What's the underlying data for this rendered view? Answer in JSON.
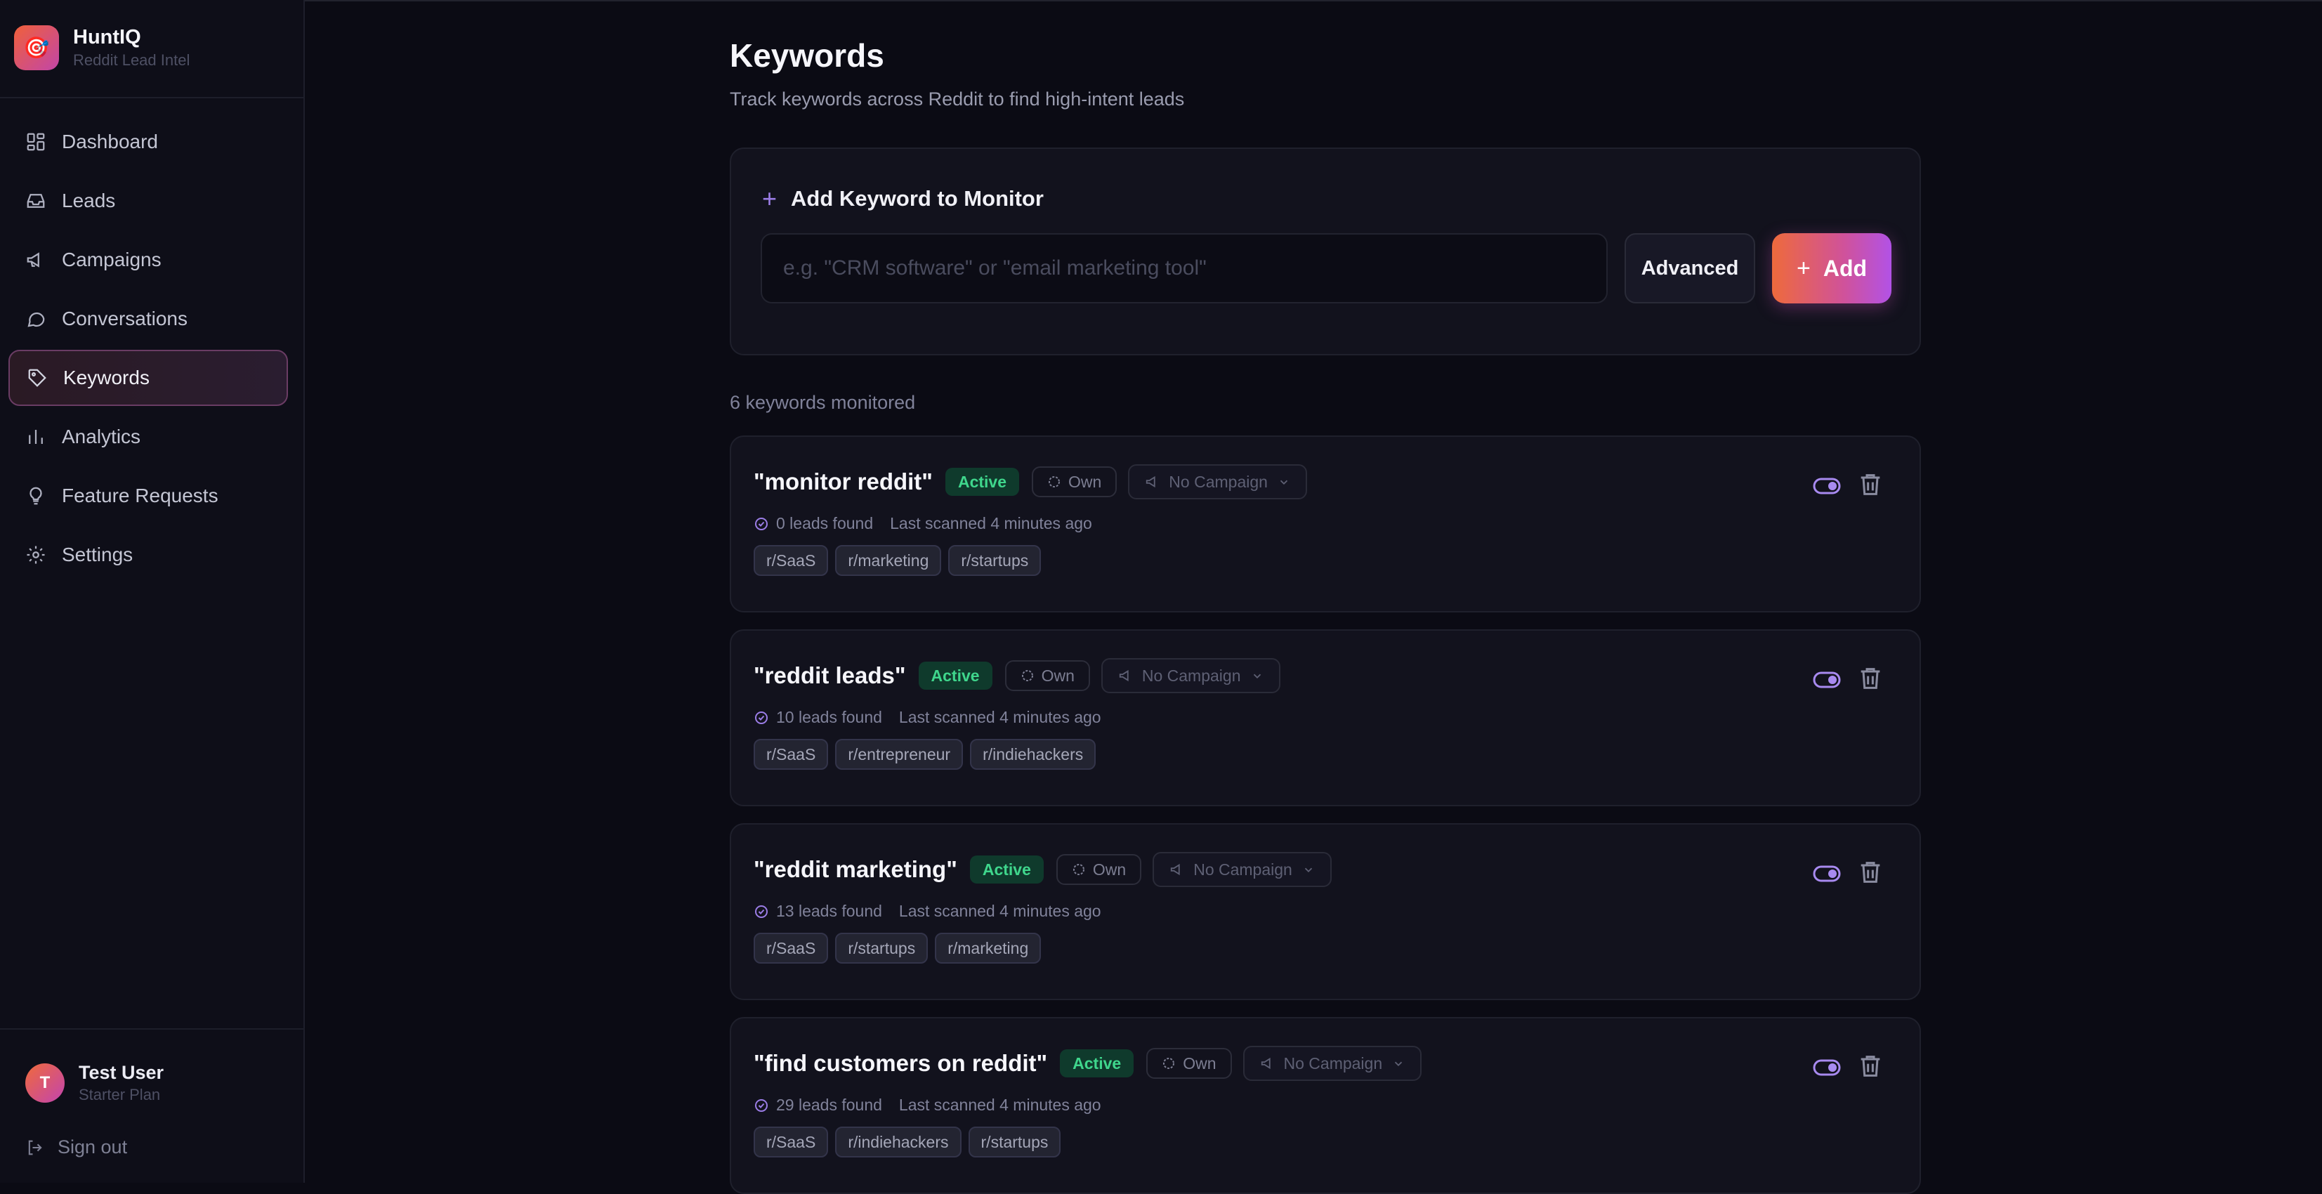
{
  "app": {
    "name": "HuntIQ",
    "tagline": "Reddit Lead Intel",
    "logo_glyph": "🎯"
  },
  "nav": [
    {
      "label": "Dashboard",
      "icon": "dashboard-icon",
      "active": false
    },
    {
      "label": "Leads",
      "icon": "inbox-icon",
      "active": false
    },
    {
      "label": "Campaigns",
      "icon": "megaphone-icon",
      "active": false
    },
    {
      "label": "Conversations",
      "icon": "chat-bubble-icon",
      "active": false
    },
    {
      "label": "Keywords",
      "icon": "tag-icon",
      "active": true
    },
    {
      "label": "Analytics",
      "icon": "bar-chart-icon",
      "active": false
    },
    {
      "label": "Feature Requests",
      "icon": "lightbulb-icon",
      "active": false
    },
    {
      "label": "Settings",
      "icon": "gear-icon",
      "active": false
    }
  ],
  "user": {
    "initial": "T",
    "name": "Test User",
    "plan": "Starter Plan",
    "signout_label": "Sign out"
  },
  "page": {
    "title": "Keywords",
    "subtitle": "Track keywords across Reddit to find high-intent leads"
  },
  "add_form": {
    "heading": "Add Keyword to Monitor",
    "input_placeholder": "e.g. \"CRM software\" or \"email marketing tool\"",
    "input_value": "",
    "advanced_label": "Advanced",
    "add_label": "Add"
  },
  "count_label": "6 keywords monitored",
  "keywords": [
    {
      "term": "\"monitor reddit\"",
      "status": "Active",
      "owner": "Own",
      "campaign": "No Campaign",
      "leads": "0 leads found",
      "scanned": "Last scanned 4 minutes ago",
      "subreddits": [
        "r/SaaS",
        "r/marketing",
        "r/startups"
      ]
    },
    {
      "term": "\"reddit leads\"",
      "status": "Active",
      "owner": "Own",
      "campaign": "No Campaign",
      "leads": "10 leads found",
      "scanned": "Last scanned 4 minutes ago",
      "subreddits": [
        "r/SaaS",
        "r/entrepreneur",
        "r/indiehackers"
      ]
    },
    {
      "term": "\"reddit marketing\"",
      "status": "Active",
      "owner": "Own",
      "campaign": "No Campaign",
      "leads": "13 leads found",
      "scanned": "Last scanned 4 minutes ago",
      "subreddits": [
        "r/SaaS",
        "r/startups",
        "r/marketing"
      ]
    },
    {
      "term": "\"find customers on reddit\"",
      "status": "Active",
      "owner": "Own",
      "campaign": "No Campaign",
      "leads": "29 leads found",
      "scanned": "Last scanned 4 minutes ago",
      "subreddits": [
        "r/SaaS",
        "r/indiehackers",
        "r/startups"
      ]
    }
  ],
  "colors": {
    "accent": "#9b7de6",
    "active_green": "#3fd68c",
    "brand_orange": "#ee6a3c",
    "brand_pink": "#c246a8"
  }
}
